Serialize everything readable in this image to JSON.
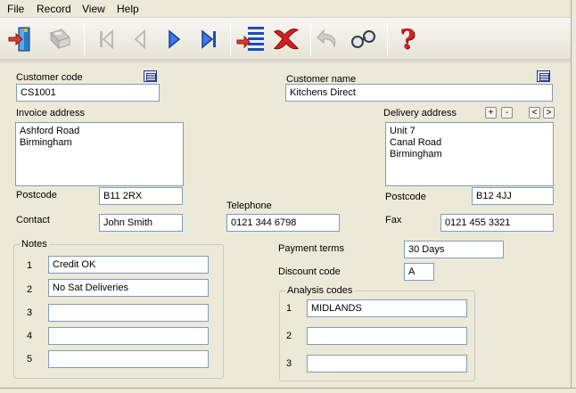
{
  "menu": {
    "file": "File",
    "record": "Record",
    "view": "View",
    "help": "Help"
  },
  "toolbar": {
    "icons": [
      "exit-icon",
      "save-icon",
      "first-record-icon",
      "previous-record-icon",
      "next-record-icon",
      "last-record-icon",
      "list-icon",
      "delete-icon",
      "undo-icon",
      "find-icon",
      "help-icon"
    ],
    "help_glyph": "?"
  },
  "customer": {
    "code_label": "Customer code",
    "code_value": "CS1001",
    "name_label": "Customer name",
    "name_value": "Kitchens Direct"
  },
  "invoice": {
    "address_label": "Invoice address",
    "address_lines": [
      "Ashford Road",
      "Birmingham"
    ],
    "postcode_label": "Postcode",
    "postcode_value": "B11 2RX",
    "contact_label": "Contact",
    "contact_value": "John Smith"
  },
  "delivery": {
    "address_label": "Delivery address",
    "address_lines": [
      "Unit 7",
      "Canal Road",
      "Birmingham"
    ],
    "postcode_label": "Postcode",
    "postcode_value": "B12 4JJ",
    "fax_label": "Fax",
    "fax_value": "0121 455 3321",
    "add_glyph": "+",
    "remove_glyph": "-",
    "prev_glyph": "<",
    "next_glyph": ">"
  },
  "telephone": {
    "label": "Telephone",
    "value": "0121 344 6798"
  },
  "notes": {
    "title": "Notes",
    "rows": [
      {
        "n": "1",
        "value": "Credit OK"
      },
      {
        "n": "2",
        "value": "No Sat Deliveries"
      },
      {
        "n": "3",
        "value": ""
      },
      {
        "n": "4",
        "value": ""
      },
      {
        "n": "5",
        "value": ""
      }
    ]
  },
  "terms": {
    "payment_label": "Payment terms",
    "payment_value": "30 Days",
    "discount_label": "Discount code",
    "discount_value": "A"
  },
  "analysis": {
    "title": "Analysis codes",
    "rows": [
      {
        "n": "1",
        "value": "MIDLANDS"
      },
      {
        "n": "2",
        "value": ""
      },
      {
        "n": "3",
        "value": ""
      }
    ]
  },
  "colors": {
    "form_bg": "#ece9d8",
    "input_border": "#7f9db9",
    "delete_red": "#d42020",
    "nav_blue": "#1c55c8"
  }
}
